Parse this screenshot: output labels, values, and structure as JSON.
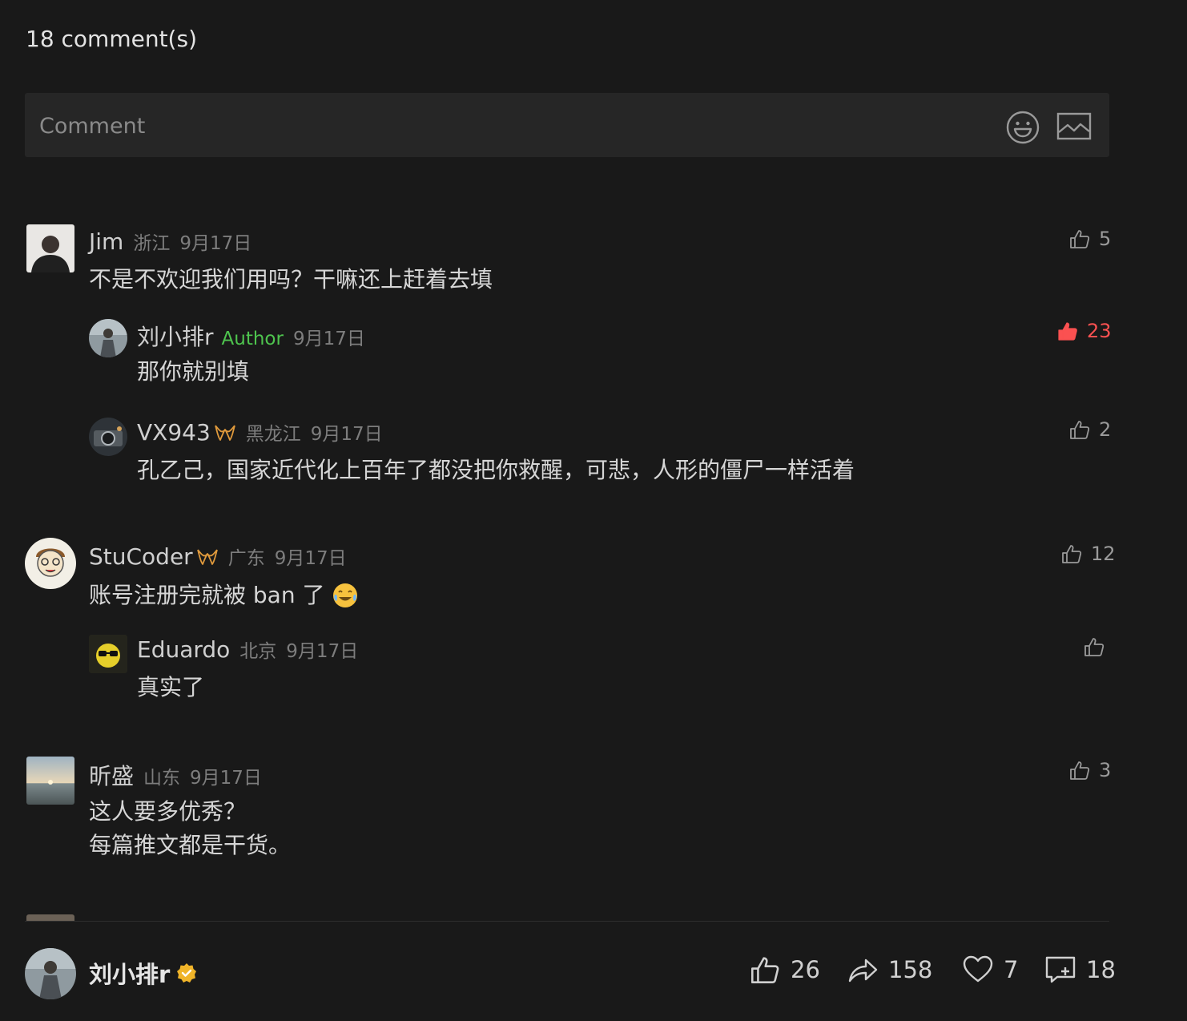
{
  "header": {
    "comment_count_label": "18 comment(s)"
  },
  "composer": {
    "placeholder": "Comment",
    "emoji_icon": "smiley-icon",
    "image_icon": "image-icon"
  },
  "comments": [
    {
      "name": "Jim",
      "location": "浙江",
      "date": "9月17日",
      "text": "不是不欢迎我们用吗？干嘛还上赶着去填",
      "likes": "5"
    },
    {
      "name": "刘小排r",
      "tag": "Author",
      "date": "9月17日",
      "text": "那你就别填",
      "likes": "23",
      "liked": true
    },
    {
      "name": "VX943",
      "location": "黑龙江",
      "date": "9月17日",
      "text": "孔乙己，国家近代化上百年了都没把你救醒，可悲，人形的僵尸一样活着",
      "likes": "2"
    },
    {
      "name": "StuCoder",
      "location": "广东",
      "date": "9月17日",
      "text": "账号注册完就被 ban 了",
      "likes": "12"
    },
    {
      "name": "Eduardo",
      "location": "北京",
      "date": "9月17日",
      "text": "真实了",
      "likes": ""
    },
    {
      "name": "昕盛",
      "location": "山东",
      "date": "9月17日",
      "text_line1": "这人要多优秀？",
      "text_line2": "每篇推文都是干货。",
      "likes": "3"
    }
  ],
  "footer": {
    "author_name": "刘小排r",
    "likes": "26",
    "shares": "158",
    "favorites": "7",
    "comments": "18"
  },
  "colors": {
    "background": "#191919",
    "accent_red": "#fa5151",
    "author_green": "#4ec44e",
    "badge_orange": "#e09a3c",
    "verified_gold": "#f0b429"
  }
}
